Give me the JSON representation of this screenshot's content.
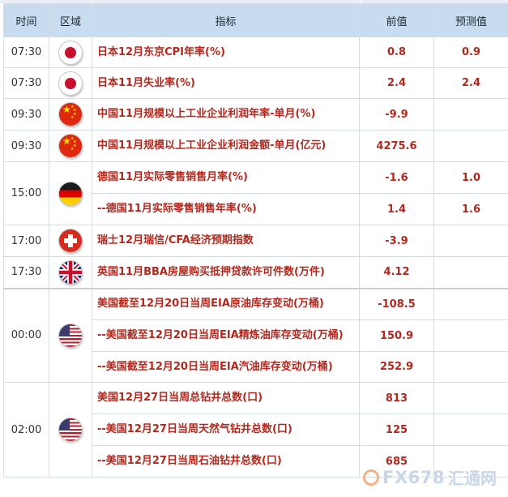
{
  "headers": {
    "time": "时间",
    "region": "区域",
    "indicator": "指标",
    "previous": "前值",
    "forecast": "预测值"
  },
  "groups": [
    {
      "time": "07:30",
      "flag": "japan-flag-icon",
      "rows": [
        {
          "indicator": "日本12月东京CPI年率(%)",
          "previous": "0.8",
          "forecast": "0.9"
        }
      ]
    },
    {
      "time": "07:30",
      "flag": "japan-flag-icon",
      "rows": [
        {
          "indicator": "日本11月失业率(%)",
          "previous": "2.4",
          "forecast": "2.4"
        }
      ]
    },
    {
      "time": "09:30",
      "flag": "china-flag-icon",
      "rows": [
        {
          "indicator": "中国11月规模以上工业企业利润年率-单月(%)",
          "previous": "-9.9",
          "forecast": ""
        }
      ]
    },
    {
      "time": "09:30",
      "flag": "china-flag-icon",
      "rows": [
        {
          "indicator": "中国11月规模以上工业企业利润金额-单月(亿元)",
          "previous": "4275.6",
          "forecast": ""
        }
      ]
    },
    {
      "time": "15:00",
      "flag": "germany-flag-icon",
      "rows": [
        {
          "indicator": "德国11月实际零售销售月率(%)",
          "previous": "-1.6",
          "forecast": "1.0"
        },
        {
          "indicator": "--德国11月实际零售销售年率(%)",
          "previous": "1.4",
          "forecast": "1.6"
        }
      ]
    },
    {
      "time": "17:00",
      "flag": "switzerland-flag-icon",
      "rows": [
        {
          "indicator": "瑞士12月瑞信/CFA经济预期指数",
          "previous": "-3.9",
          "forecast": ""
        }
      ]
    },
    {
      "time": "17:30",
      "flag": "uk-flag-icon",
      "rows": [
        {
          "indicator": "英国11月BBA房屋购买抵押贷款许可件数(万件)",
          "previous": "4.12",
          "forecast": ""
        }
      ]
    },
    {
      "time": "00:00",
      "flag": "usa-flag-icon",
      "rows": [
        {
          "indicator": "美国截至12月20日当周EIA原油库存变动(万桶)",
          "previous": "-108.5",
          "forecast": ""
        },
        {
          "indicator": "--美国截至12月20日当周EIA精炼油库存变动(万桶)",
          "previous": "150.9",
          "forecast": ""
        },
        {
          "indicator": "--美国截至12月20日当周EIA汽油库存变动(万桶)",
          "previous": "252.9",
          "forecast": ""
        }
      ]
    },
    {
      "time": "02:00",
      "flag": "usa-flag-icon",
      "rows": [
        {
          "indicator": "美国12月27日当周总钻井总数(口)",
          "previous": "813",
          "forecast": ""
        },
        {
          "indicator": "--美国12月27日当周天然气钻井总数(口)",
          "previous": "125",
          "forecast": ""
        },
        {
          "indicator": "--美国12月27日当周石油钻井总数(口)",
          "previous": "685",
          "forecast": ""
        }
      ]
    }
  ],
  "watermark": {
    "brand": "FX678",
    "cn": "汇通网"
  },
  "colors": {
    "header_bg": "#c8dcef",
    "value_red": "#b3281e",
    "border": "#d6dde7"
  }
}
